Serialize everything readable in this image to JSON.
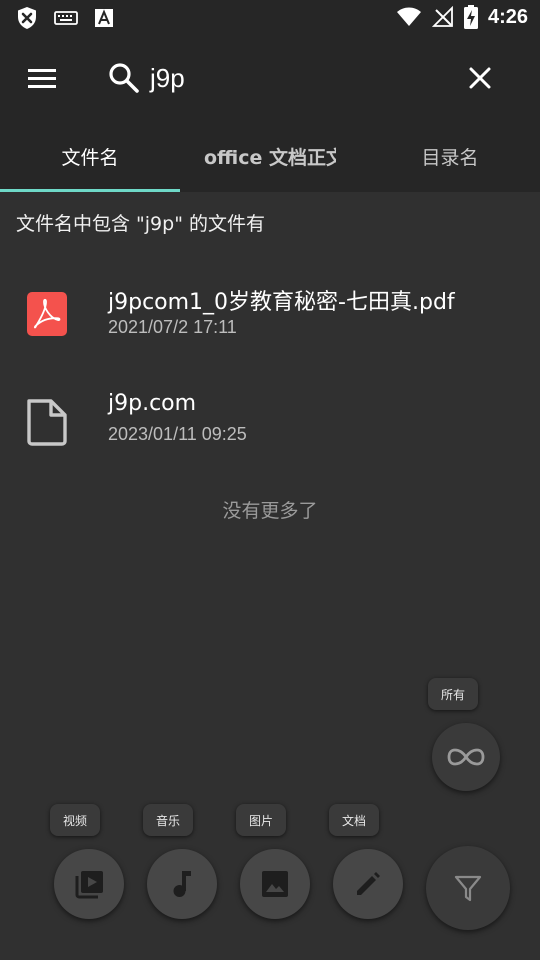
{
  "status_bar": {
    "time": "4:26",
    "left_icons": [
      "shield-icon",
      "keyboard-icon",
      "text-a-icon"
    ],
    "right_icons": [
      "wifi-icon",
      "no-signal-icon",
      "battery-charging-icon"
    ]
  },
  "search": {
    "query": "j9p"
  },
  "tabs": [
    {
      "label": "文件名",
      "active": true
    },
    {
      "label": "office 文档正文",
      "active": false
    },
    {
      "label": "目录名",
      "active": false
    }
  ],
  "results": {
    "caption": "文件名中包含 \"j9p\" 的文件有",
    "items": [
      {
        "name": "j9pcom1_0岁教育秘密-七田真.pdf",
        "date": "2021/07/2  17:11",
        "icon": "pdf-icon"
      },
      {
        "name": "j9p.com",
        "date": "2023/01/11  09:25",
        "icon": "file-icon"
      }
    ],
    "footer": "没有更多了"
  },
  "filters": {
    "all_label": "所有",
    "video_label": "视频",
    "music_label": "音乐",
    "image_label": "图片",
    "doc_label": "文档"
  },
  "colors": {
    "background": "#303030",
    "bar": "#262626",
    "accent": "#6fd9c8",
    "pdf_red": "#f4524d"
  }
}
